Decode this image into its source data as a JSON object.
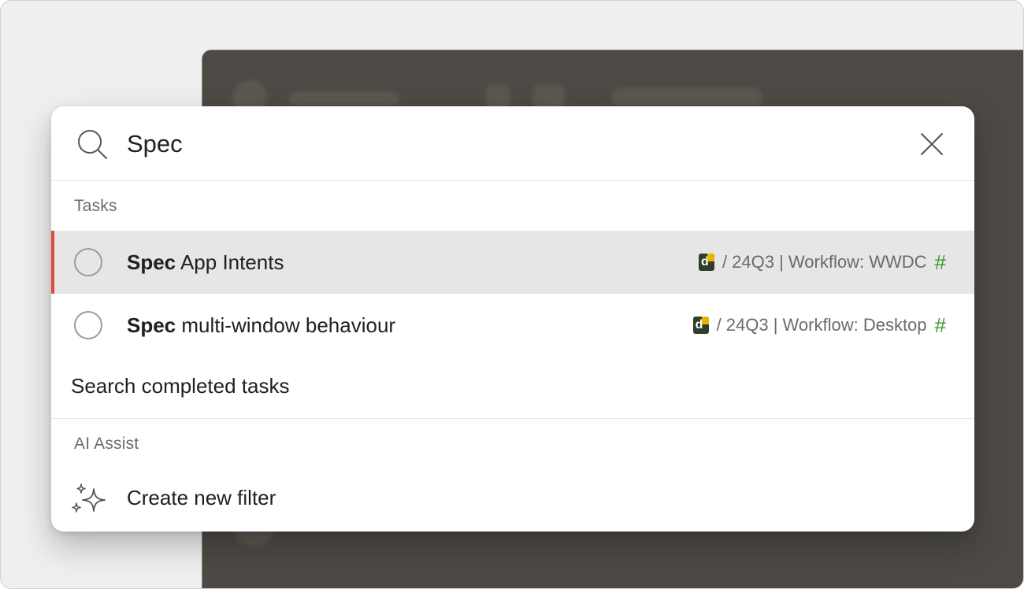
{
  "search": {
    "query": "Spec"
  },
  "sections": {
    "tasks_label": "Tasks",
    "ai_label": "AI Assist"
  },
  "tasks": [
    {
      "match": "Spec",
      "rest": "App Intents",
      "project_badge": "d",
      "meta": "/ 24Q3 | Workflow: WWDC",
      "hash": "#",
      "selected": true
    },
    {
      "match": "Spec",
      "rest": "multi-window behaviour",
      "project_badge": "d",
      "meta": "/ 24Q3 | Workflow: Desktop",
      "hash": "#",
      "selected": false
    }
  ],
  "search_completed_label": "Search completed tasks",
  "ai_assist": {
    "create_filter_label": "Create new filter"
  },
  "colors": {
    "accent": "#dc4c3e",
    "hash": "#3a9a28",
    "selected_row": "#e6e6e6"
  }
}
